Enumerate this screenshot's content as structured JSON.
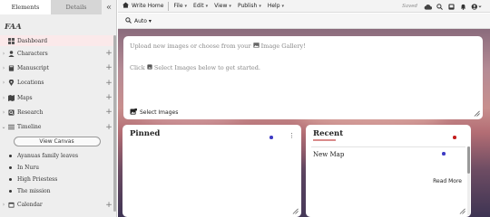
{
  "sidebar": {
    "tabs": {
      "elements": "Elements",
      "details": "Details"
    },
    "collapse_glyph": "«",
    "brand": "FAA",
    "items": [
      {
        "label": "Dashboard",
        "icon": "dashboard-icon",
        "active": true
      },
      {
        "label": "Characters",
        "icon": "person-icon"
      },
      {
        "label": "Manuscript",
        "icon": "book-icon"
      },
      {
        "label": "Locations",
        "icon": "location-pin-icon"
      },
      {
        "label": "Maps",
        "icon": "map-icon"
      },
      {
        "label": "Research",
        "icon": "research-icon"
      },
      {
        "label": "Timeline",
        "icon": "timeline-icon",
        "expanded": true
      },
      {
        "label": "Calendar",
        "icon": "calendar-icon"
      }
    ],
    "view_canvas": "View Canvas",
    "timeline_entries": [
      "Ayanuas family leaves",
      "In Nuru",
      "High Priestess",
      "The mission"
    ]
  },
  "topbar": {
    "home": "Write Home",
    "menus": [
      "File",
      "Edit",
      "View",
      "Publish",
      "Help"
    ],
    "status": "Saved"
  },
  "subbar": {
    "zoom": "Auto"
  },
  "upload": {
    "line1_prefix": "Upload new images or choose from your",
    "line1_link": "Image Gallery!",
    "line2_prefix": "Click",
    "line2_link": "Select Images",
    "line2_suffix": "below to get started.",
    "select_label": "Select Images"
  },
  "pinned": {
    "title": "Pinned",
    "kebab": "⋮"
  },
  "recent": {
    "title": "Recent",
    "items": [
      "New Map"
    ],
    "read_more": "Read More"
  },
  "colors": {
    "accent_blue": "#3e3bc4",
    "accent_red": "#c41e1e",
    "active_bg": "#fbe9ea"
  }
}
